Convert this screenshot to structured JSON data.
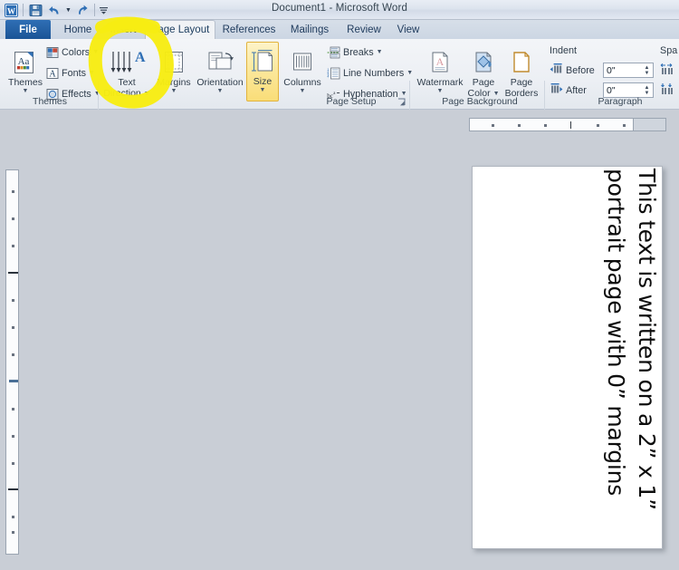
{
  "window": {
    "title": "Document1  -  Microsoft Word"
  },
  "quick_access": {
    "items": [
      {
        "name": "word-logo-icon",
        "label": "W"
      },
      {
        "name": "save-icon",
        "label": "Save"
      },
      {
        "name": "undo-icon",
        "label": "Undo"
      },
      {
        "name": "redo-icon",
        "label": "Redo"
      },
      {
        "name": "customize-quick-access-icon",
        "label": "Customize Quick Access Toolbar"
      }
    ]
  },
  "tabs": [
    {
      "label": "File",
      "active": false,
      "file": true
    },
    {
      "label": "Home",
      "active": false
    },
    {
      "label": "Insert",
      "active": false
    },
    {
      "label": "Page Layout",
      "active": true
    },
    {
      "label": "References",
      "active": false
    },
    {
      "label": "Mailings",
      "active": false
    },
    {
      "label": "Review",
      "active": false
    },
    {
      "label": "View",
      "active": false
    }
  ],
  "ribbon": {
    "groups": [
      {
        "name": "themes",
        "label": "Themes"
      },
      {
        "name": "page-setup",
        "label": "Page Setup"
      },
      {
        "name": "page-background",
        "label": "Page Background"
      },
      {
        "name": "paragraph",
        "label": "Paragraph"
      }
    ],
    "themes": {
      "big_button": {
        "label": "Themes"
      },
      "colors": "Colors",
      "fonts": "Fonts",
      "effects": "Effects"
    },
    "page_setup": {
      "text_direction": {
        "line1": "Text",
        "line2": "Direction",
        "highlighted": true
      },
      "margins": "Margins",
      "orientation": "Orientation",
      "size": {
        "label": "Size",
        "selected": true
      },
      "columns": "Columns",
      "breaks": "Breaks",
      "line_numbers": "Line Numbers",
      "hyphenation": "Hyphenation"
    },
    "page_background": {
      "watermark": "Watermark",
      "page_color_line1": "Page",
      "page_color_line2": "Color",
      "page_borders_line1": "Page",
      "page_borders_line2": "Borders"
    },
    "paragraph": {
      "indent_title": "Indent",
      "spacing_title": "Spa",
      "before_label": "Before",
      "before_value": "0\"",
      "after_label": "After",
      "after_value": "0\""
    }
  },
  "document": {
    "page_text": "This text is written on a 2” x 1” portrait page with 0” margins",
    "orientation": "portrait"
  },
  "annotation": {
    "type": "highlighter-circle",
    "target": "text-direction-button",
    "color": "#f7ec13"
  },
  "colors": {
    "highlighter": "#f7ec13",
    "selected_button": "#f9dd78",
    "canvas": "#c9ced6",
    "file_tab": "#1b5496"
  }
}
